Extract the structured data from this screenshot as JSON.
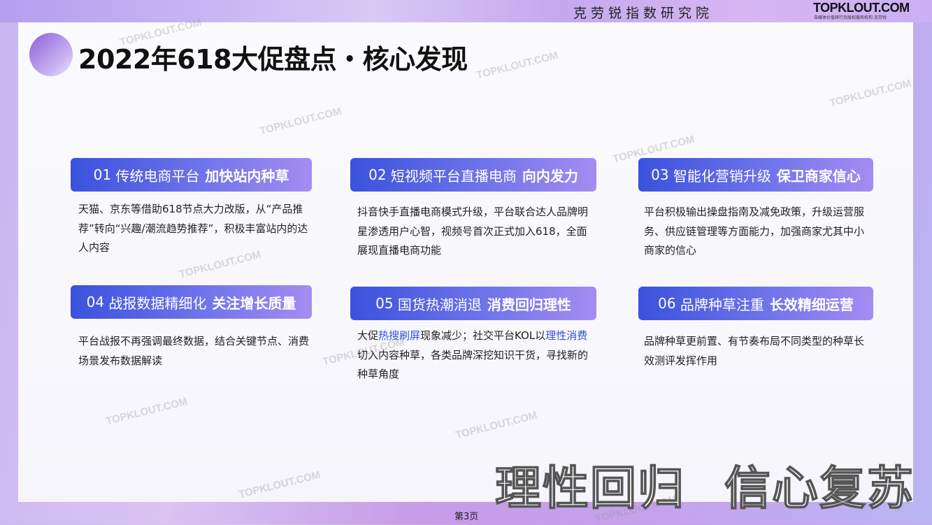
{
  "header": {
    "institute": "克劳锐指数研究院",
    "brand": "TOPKLOUT.COM",
    "brand_sub": "自媒体价值排行及版权服务机构 克劳锐"
  },
  "title": "2022年618大促盘点・核心发现",
  "findings": [
    {
      "num": "01",
      "label": "传统电商平台",
      "emph": "加快站内种草",
      "body": "天猫、京东等借助618节点大力改版，从“产品推荐”转向“兴趣/潮流趋势推荐”，积极丰富站内的达人内容"
    },
    {
      "num": "02",
      "label": "短视频平台直播电商",
      "emph": "向内发力",
      "body": "抖音快手直播电商模式升级，平台联合达人品牌明星渗透用户心智，视频号首次正式加入618，全面展现直播电商功能"
    },
    {
      "num": "03",
      "label": "智能化营销升级",
      "emph": "保卫商家信心",
      "body": "平台积极输出操盘指南及减免政策，升级运营服务、供应链管理等方面能力，加强商家尤其中小商家的信心"
    },
    {
      "num": "04",
      "label": "战报数据精细化",
      "emph": "关注增长质量",
      "body": "平台战报不再强调最终数据，结合关键节点、消费场景发布数据解读"
    },
    {
      "num": "05",
      "label": "国货热潮消退",
      "emph": "消费回归理性",
      "body_parts": [
        "大促",
        "热搜刷屏",
        "现象减少；社交平台KOL以",
        "理性消费",
        "切入内容种草，各类品牌深挖知识干货，寻找新的种草角度"
      ]
    },
    {
      "num": "06",
      "label": "品牌种草注重",
      "emph": "长效精细运营",
      "body": "品牌种草更前置、有节奏布局不同类型的种草长效测评发挥作用"
    }
  ],
  "slogans": [
    "理性回归",
    "信心复苏"
  ],
  "page": "第3页",
  "watermark": "TOPKLOUT.COM",
  "colors": {
    "accent": "#3a52dc",
    "highlight": "#3550d8"
  }
}
